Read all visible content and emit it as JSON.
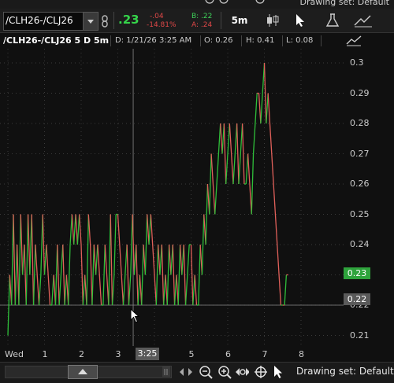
{
  "top_strip": {
    "drawing_set_partial": "Drawing set: Default"
  },
  "toolbar": {
    "symbol": "/CLH26-/CLJ26",
    "last": ".23",
    "net_change": "-.04",
    "pct_change": "-14.81%",
    "bid": "B: .22",
    "ask": "A: .24",
    "aggregation": "5m"
  },
  "chart_header": {
    "title": "/CLH26-/CLJ26 5 D 5m",
    "date": "D: 1/21/26 3:25 AM",
    "open": "O: 0.26",
    "high": "H: 0.41",
    "low": "L: 0.08"
  },
  "price_tags": {
    "last": "0.23",
    "crosshair": "0.22"
  },
  "crosshair_time": "3:25",
  "bottom_bar": {
    "drawing_set": "Drawing set: Default"
  },
  "colors": {
    "up": "#2fbf3a",
    "down": "#e0605a",
    "accent": "#35d44a",
    "grid": "#3a3a3a"
  },
  "chart_data": {
    "type": "line",
    "y_ticks": [
      "0.3",
      "0.29",
      "0.28",
      "0.27",
      "0.26",
      "0.25",
      "0.24",
      "0.23",
      "0.22",
      "0.21"
    ],
    "x_ticks": [
      "Wed",
      "1",
      "2",
      "3",
      "4",
      "5",
      "6",
      "7",
      "8"
    ],
    "ylim": [
      0.205,
      0.305
    ],
    "xlim": [
      0,
      8.6
    ],
    "grid": true,
    "series": [
      {
        "values": [
          [
            -0.9,
            0.21
          ],
          [
            -0.85,
            0.23
          ],
          [
            -0.8,
            0.22
          ],
          [
            -0.75,
            0.25
          ],
          [
            -0.7,
            0.22
          ],
          [
            -0.65,
            0.24
          ],
          [
            -0.6,
            0.22
          ],
          [
            -0.55,
            0.25
          ],
          [
            -0.5,
            0.23
          ],
          [
            -0.45,
            0.24
          ],
          [
            -0.4,
            0.22
          ],
          [
            -0.35,
            0.25
          ],
          [
            -0.3,
            0.23
          ],
          [
            -0.25,
            0.25
          ],
          [
            -0.2,
            0.22
          ],
          [
            -0.15,
            0.24
          ],
          [
            -0.1,
            0.23
          ],
          [
            -0.05,
            0.22
          ],
          [
            0,
            0.23
          ],
          [
            0.05,
            0.25
          ],
          [
            0.1,
            0.23
          ],
          [
            0.15,
            0.24
          ],
          [
            0.2,
            0.23
          ],
          [
            0.25,
            0.22
          ],
          [
            0.3,
            0.22
          ],
          [
            0.35,
            0.23
          ],
          [
            0.4,
            0.22
          ],
          [
            0.45,
            0.24
          ],
          [
            0.5,
            0.22
          ],
          [
            0.55,
            0.23
          ],
          [
            0.6,
            0.24
          ],
          [
            0.65,
            0.22
          ],
          [
            0.7,
            0.23
          ],
          [
            0.75,
            0.22
          ],
          [
            0.8,
            0.24
          ],
          [
            0.85,
            0.25
          ],
          [
            0.9,
            0.24
          ],
          [
            0.95,
            0.25
          ],
          [
            1.0,
            0.24
          ],
          [
            1.05,
            0.25
          ],
          [
            1.1,
            0.24
          ],
          [
            1.15,
            0.22
          ],
          [
            1.2,
            0.23
          ],
          [
            1.25,
            0.22
          ],
          [
            1.3,
            0.25
          ],
          [
            1.35,
            0.24
          ],
          [
            1.4,
            0.22
          ],
          [
            1.45,
            0.24
          ],
          [
            1.5,
            0.23
          ],
          [
            1.55,
            0.24
          ],
          [
            1.6,
            0.23
          ],
          [
            1.65,
            0.22
          ],
          [
            1.7,
            0.22
          ],
          [
            1.75,
            0.24
          ],
          [
            1.8,
            0.23
          ],
          [
            1.85,
            0.22
          ],
          [
            1.9,
            0.25
          ],
          [
            1.95,
            0.22
          ],
          [
            2.0,
            0.23
          ],
          [
            2.05,
            0.25
          ],
          [
            2.1,
            0.25
          ],
          [
            2.15,
            0.24
          ],
          [
            2.2,
            0.23
          ],
          [
            2.25,
            0.22
          ],
          [
            2.3,
            0.23
          ],
          [
            2.35,
            0.24
          ],
          [
            2.4,
            0.22
          ],
          [
            2.45,
            0.23
          ],
          [
            2.5,
            0.25
          ],
          [
            2.55,
            0.23
          ],
          [
            2.6,
            0.24
          ],
          [
            2.65,
            0.22
          ],
          [
            2.7,
            0.23
          ],
          [
            2.75,
            0.22
          ],
          [
            2.8,
            0.24
          ],
          [
            2.85,
            0.23
          ],
          [
            2.9,
            0.25
          ],
          [
            2.95,
            0.24
          ],
          [
            3.0,
            0.25
          ],
          [
            3.05,
            0.24
          ],
          [
            3.1,
            0.23
          ],
          [
            3.15,
            0.22
          ],
          [
            3.2,
            0.24
          ],
          [
            3.25,
            0.23
          ],
          [
            3.3,
            0.24
          ],
          [
            3.35,
            0.22
          ],
          [
            3.4,
            0.23
          ],
          [
            3.45,
            0.22
          ],
          [
            3.5,
            0.24
          ],
          [
            3.55,
            0.23
          ],
          [
            3.6,
            0.24
          ],
          [
            3.65,
            0.22
          ],
          [
            3.7,
            0.23
          ],
          [
            3.75,
            0.22
          ],
          [
            3.8,
            0.24
          ],
          [
            3.85,
            0.23
          ],
          [
            3.9,
            0.24
          ],
          [
            3.95,
            0.22
          ],
          [
            4.0,
            0.23
          ],
          [
            4.05,
            0.24
          ],
          [
            4.1,
            0.24
          ],
          [
            4.15,
            0.22
          ],
          [
            4.2,
            0.23
          ],
          [
            4.25,
            0.22
          ],
          [
            4.3,
            0.22
          ],
          [
            4.35,
            0.24
          ],
          [
            4.4,
            0.23
          ],
          [
            4.45,
            0.25
          ],
          [
            4.5,
            0.24
          ],
          [
            4.55,
            0.26
          ],
          [
            4.6,
            0.25
          ],
          [
            4.65,
            0.27
          ],
          [
            4.7,
            0.26
          ],
          [
            4.75,
            0.25
          ],
          [
            4.8,
            0.26
          ],
          [
            4.85,
            0.27
          ],
          [
            4.9,
            0.28
          ],
          [
            4.95,
            0.27
          ],
          [
            5.0,
            0.28
          ],
          [
            5.05,
            0.26
          ],
          [
            5.1,
            0.27
          ],
          [
            5.15,
            0.28
          ],
          [
            5.2,
            0.27
          ],
          [
            5.25,
            0.26
          ],
          [
            5.3,
            0.27
          ],
          [
            5.35,
            0.28
          ],
          [
            5.4,
            0.26
          ],
          [
            5.45,
            0.27
          ],
          [
            5.5,
            0.28
          ],
          [
            5.55,
            0.26
          ],
          [
            5.6,
            0.26
          ],
          [
            5.65,
            0.27
          ],
          [
            5.7,
            0.26
          ],
          [
            5.75,
            0.25
          ],
          [
            5.8,
            0.27
          ],
          [
            5.85,
            0.28
          ],
          [
            5.9,
            0.29
          ],
          [
            5.95,
            0.29
          ],
          [
            6.0,
            0.28
          ],
          [
            6.05,
            0.29
          ],
          [
            6.1,
            0.3
          ],
          [
            6.15,
            0.28
          ],
          [
            6.2,
            0.29
          ],
          [
            6.25,
            0.28
          ],
          [
            6.3,
            0.27
          ],
          [
            6.35,
            0.26
          ],
          [
            6.4,
            0.25
          ],
          [
            6.45,
            0.24
          ],
          [
            6.5,
            0.23
          ],
          [
            6.55,
            0.22
          ],
          [
            6.6,
            0.22
          ],
          [
            6.65,
            0.22
          ],
          [
            6.7,
            0.23
          ],
          [
            6.75,
            0.23
          ]
        ]
      }
    ]
  }
}
